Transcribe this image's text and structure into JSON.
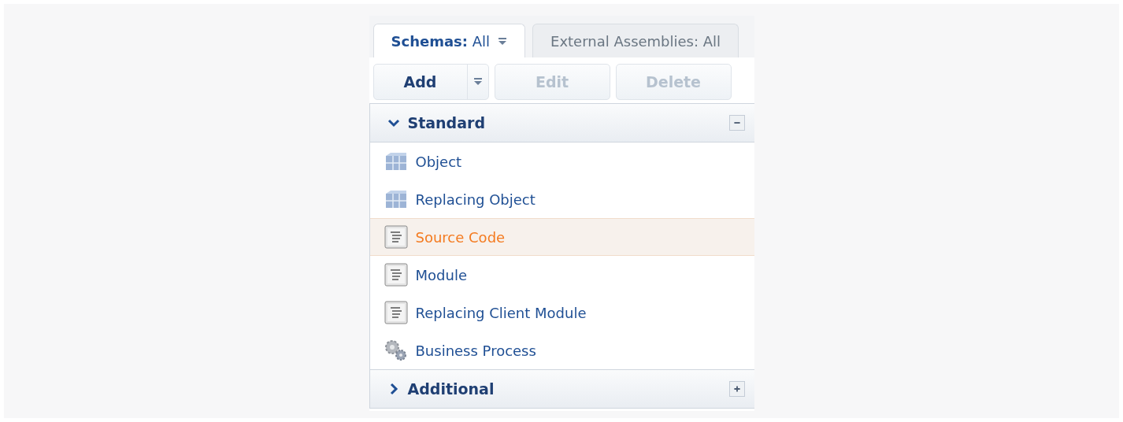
{
  "tabs": [
    {
      "label": "**Schemas:** All",
      "selected": true,
      "has_menu": true
    },
    {
      "label": "External Assemblies: All",
      "selected": false,
      "has_menu": false
    }
  ],
  "toolbar": {
    "buttons": [
      {
        "label": "Add",
        "disabled": false,
        "has_menu": true
      },
      {
        "label": "Edit",
        "disabled": true,
        "has_menu": false
      },
      {
        "label": "Delete",
        "disabled": true,
        "has_menu": false
      }
    ]
  },
  "groups": [
    {
      "title": "Standard",
      "expanded": true,
      "items": [
        {
          "label": "Object",
          "kind": "object",
          "selected": false
        },
        {
          "label": "Replacing Object",
          "kind": "object",
          "selected": false
        },
        {
          "label": "Source Code",
          "kind": "code",
          "selected": true
        },
        {
          "label": "Module",
          "kind": "code",
          "selected": false
        },
        {
          "label": "Replacing Client Module",
          "kind": "code",
          "selected": false
        },
        {
          "label": "Business Process",
          "kind": "process",
          "selected": false
        }
      ]
    },
    {
      "title": "Additional",
      "expanded": false
    }
  ]
}
